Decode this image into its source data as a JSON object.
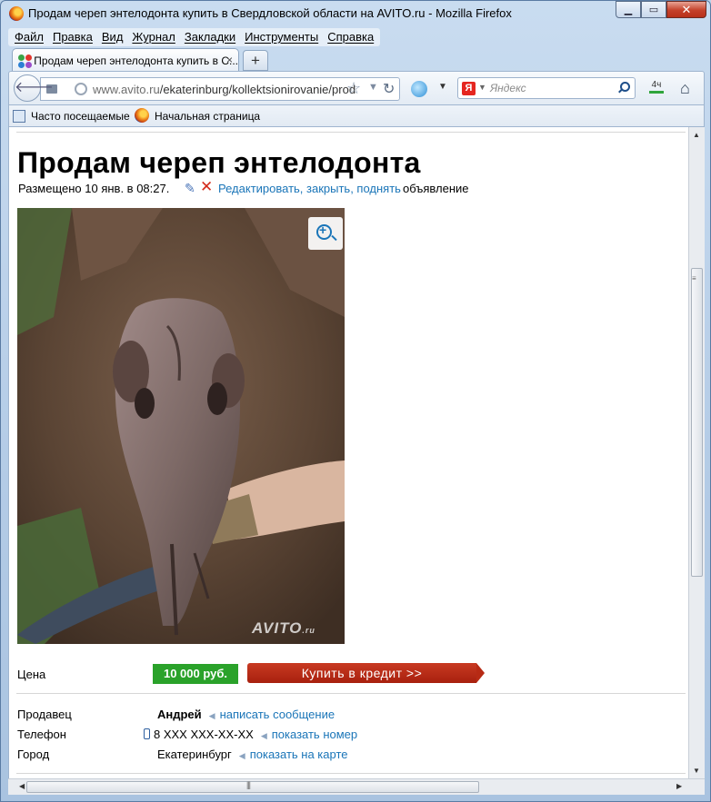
{
  "window": {
    "title": "Продам череп энтелодонта купить в Свердловской области на AVITO.ru - Mozilla Firefox"
  },
  "menu": [
    "Файл",
    "Правка",
    "Вид",
    "Журнал",
    "Закладки",
    "Инструменты",
    "Справка"
  ],
  "tab": {
    "label": "Продам череп энтелодонта купить в С...",
    "close": "×",
    "new_tab": "+"
  },
  "nav": {
    "url_host": "www.avito.ru",
    "url_path": "/ekaterinburg/kollektsionirovanie/prod",
    "search_placeholder": "Яндекс",
    "search_engine": "Я",
    "weather": "4ч"
  },
  "bookmarks": [
    "Часто посещаемые",
    "Начальная страница"
  ],
  "ad": {
    "title": "Продам череп энтелодонта",
    "posted": "Размещено 10 янв. в 08:27.",
    "edit_link": "Редактировать, закрыть, поднять",
    "edit_suffix": "объявление",
    "watermark": "AVITO",
    "watermark_suffix": ".ru",
    "price_label": "Цена",
    "price": "10 000 руб.",
    "credit_button": "Купить в кредит >>",
    "seller_label": "Продавец",
    "seller_name": "Андрей",
    "seller_link": "написать сообщение",
    "phone_label": "Телефон",
    "phone_value": "8 XXX XXX-XX-XX",
    "phone_link": "показать номер",
    "city_label": "Город",
    "city_value": "Екатеринбург",
    "city_link": "показать на карте"
  },
  "colors": {
    "link": "#1a75b8",
    "price_green": "#2aa22a",
    "credit_red": "#b72a14"
  }
}
